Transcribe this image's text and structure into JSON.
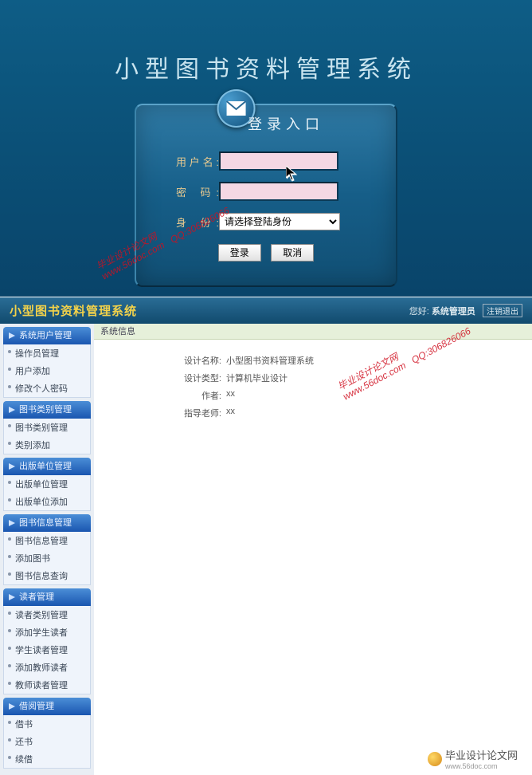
{
  "login": {
    "system_title": "小型图书资料管理系统",
    "header": "登录入口",
    "username_label": "用户名:",
    "password_label": "密 码:",
    "role_label": "身 份:",
    "role_placeholder": "请选择登陆身份",
    "submit_label": "登录",
    "cancel_label": "取消"
  },
  "admin": {
    "title": "小型图书资料管理系统",
    "welcome_prefix": "您好:",
    "current_user": "系统管理员",
    "logout_label": "注销退出",
    "crumb": "系统信息",
    "info": {
      "design_name_label": "设计名称:",
      "design_name_value": "小型图书资料管理系统",
      "design_type_label": "设计类型:",
      "design_type_value": "计算机毕业设计",
      "author_label": "作者:",
      "author_value": "xx",
      "advisor_label": "指导老师:",
      "advisor_value": "xx"
    },
    "sidebar": [
      {
        "header": "系统用户管理",
        "items": [
          "操作员管理",
          "用户添加",
          "修改个人密码"
        ]
      },
      {
        "header": "图书类别管理",
        "items": [
          "图书类别管理",
          "类别添加"
        ]
      },
      {
        "header": "出版单位管理",
        "items": [
          "出版单位管理",
          "出版单位添加"
        ]
      },
      {
        "header": "图书信息管理",
        "items": [
          "图书信息管理",
          "添加图书",
          "图书信息查询"
        ]
      },
      {
        "header": "读者管理",
        "items": [
          "读者类别管理",
          "添加学生读者",
          "学生读者管理",
          "添加教师读者",
          "教师读者管理"
        ]
      },
      {
        "header": "借阅管理",
        "items": [
          "借书",
          "还书",
          "续借"
        ]
      }
    ]
  },
  "footer": {
    "brand": "毕业设计论文网",
    "url": "www.56doc.com"
  },
  "watermark": {
    "text": "毕业设计论文网\nwww.56doc.com   QQ:306826066"
  }
}
